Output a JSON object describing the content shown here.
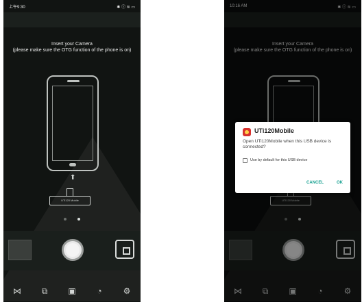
{
  "left_screen": {
    "status_time": "上午9:30",
    "status_icons": "✱ ⓘ ≋ ▭",
    "instruction": "Insert your Camera\n(please make sure the OTG function of the phone is on)",
    "connector_label": "UTi120 Mobile"
  },
  "right_screen": {
    "status_time": "10:16 AM",
    "status_icons": "✱ ⓘ ≋ ▭",
    "instruction": "Insert your Camera\n(please make sure the OTG function of the phone is on)",
    "connector_label": "UTi120 Mobile"
  },
  "dialog": {
    "title": "UTi120Mobile",
    "message": "Open UTi120Mobile when this USB device is connected?",
    "checkbox_label": "Use by default for this USB device",
    "cancel_label": "CANCEL",
    "ok_label": "OK"
  },
  "bottom_nav_icons": [
    "compare-icon",
    "layers-icon",
    "gallery-icon",
    "palette-icon",
    "settings-icon"
  ],
  "colors": {
    "accent": "#16a090",
    "app_icon": "#d8322e"
  }
}
